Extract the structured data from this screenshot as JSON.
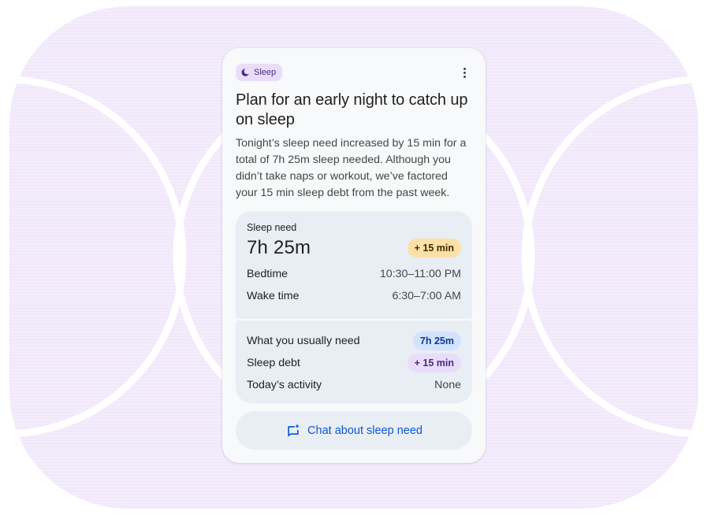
{
  "card": {
    "chip_label": "Sleep",
    "chip_icon": "moon-icon",
    "more_icon": "more-vert-icon",
    "title": "Plan for an early night to catch up on sleep",
    "description": "Tonight’s sleep need increased by 15 min for a total of 7h 25m sleep needed. Although you didn’t take naps or workout, we’ve factored your 15 min sleep debt from the past week."
  },
  "sleep_need": {
    "label": "Sleep need",
    "value": "7h 25m",
    "change_badge": "+ 15 min",
    "rows": [
      {
        "label": "Bedtime",
        "value": "10:30–11:00 PM"
      },
      {
        "label": "Wake time",
        "value": "6:30–7:00 AM"
      }
    ]
  },
  "breakdown": [
    {
      "label": "What you usually need",
      "value": "7h 25m"
    },
    {
      "label": "Sleep debt",
      "value": "+ 15 min"
    },
    {
      "label": "Today’s activity",
      "value": "None"
    }
  ],
  "chat_button": {
    "label": "Chat about sleep need",
    "icon": "chat-spark-icon"
  },
  "colors": {
    "chip_bg": "#e9ddfa",
    "change_badge_bg": "#fde0a6",
    "usual_badge_bg": "#d3e3fd",
    "debt_badge_bg": "#e9ddfa",
    "accent_blue": "#0b57d0"
  }
}
